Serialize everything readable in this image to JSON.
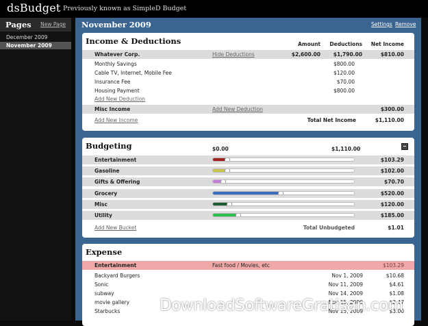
{
  "app": {
    "name": "dsBudget",
    "tagline": "Previously known as SimpleD Budget"
  },
  "sidebar": {
    "title": "Pages",
    "new_page": "New Page",
    "items": [
      {
        "label": "December 2009",
        "active": false
      },
      {
        "label": "November 2009",
        "active": true
      }
    ]
  },
  "main": {
    "title": "November 2009",
    "settings": "Settings",
    "remove": "Remove"
  },
  "income": {
    "title": "Income & Deductions",
    "columns": {
      "amount": "Amount",
      "deductions": "Deductions",
      "net_income": "Net Income"
    },
    "source1": {
      "name": "Whatever Corp.",
      "hide": "Hide Deductions",
      "amount": "$2,600.00",
      "deductions": "$1,790.00",
      "net": "$810.00"
    },
    "deductions": [
      {
        "name": "Monthly Savings",
        "value": "$800.00"
      },
      {
        "name": "Cable TV, Internet, Mobile Fee",
        "value": "$120.00"
      },
      {
        "name": "Insurance Fee",
        "value": "$70.00"
      },
      {
        "name": "Housing Payment",
        "value": "$800.00"
      }
    ],
    "add_deduction": "Add New Deduction",
    "source2": {
      "name": "Misc Income",
      "add_deduction": "Add New Deduction",
      "net": "$300.00"
    },
    "add_income": "Add New Income",
    "total_label": "Total Net Income",
    "total_value": "$1,110.00"
  },
  "budgeting": {
    "title": "Budgeting",
    "scale_min": "$0.00",
    "scale_max": "$1,110.00",
    "buckets": [
      {
        "name": "Entertainment",
        "value": "$103.29",
        "color": "#a01e1e",
        "fraction": 0.093
      },
      {
        "name": "Gasoline",
        "value": "$102.00",
        "color": "#c9c24a",
        "fraction": 0.092
      },
      {
        "name": "Gifts & Offering",
        "value": "$70.70",
        "color": "#c57cd6",
        "fraction": 0.064
      },
      {
        "name": "Grocery",
        "value": "$520.00",
        "color": "#3d6bbb",
        "fraction": 0.468
      },
      {
        "name": "Misc",
        "value": "$120.00",
        "color": "#1f5a33",
        "fraction": 0.108
      },
      {
        "name": "Utility",
        "value": "$185.00",
        "color": "#2fbf4f",
        "fraction": 0.167
      }
    ],
    "add_bucket": "Add New Bucket",
    "unbudgeted_label": "Total Unbudgeted",
    "unbudgeted_value": "$1.01"
  },
  "expense": {
    "title": "Expense",
    "category": {
      "name": "Entertainment",
      "note": "Fast food / Movies, etc",
      "value": "$103.29"
    },
    "items": [
      {
        "name": "Backyard Burgers",
        "date": "Nov 1, 2009",
        "amount": "$10.68"
      },
      {
        "name": "Sonic",
        "date": "Nov 11, 2009",
        "amount": "$4.61"
      },
      {
        "name": "subway",
        "date": "Nov 14, 2009",
        "amount": "$1.08"
      },
      {
        "name": "movie gallery",
        "date": "Nov 15, 2009",
        "amount": "$2.47"
      },
      {
        "name": "Starbucks",
        "date": "Nov 15, 2009",
        "amount": "$3.00"
      }
    ]
  },
  "watermark": "DownloadSoftwareGratisan.com"
}
